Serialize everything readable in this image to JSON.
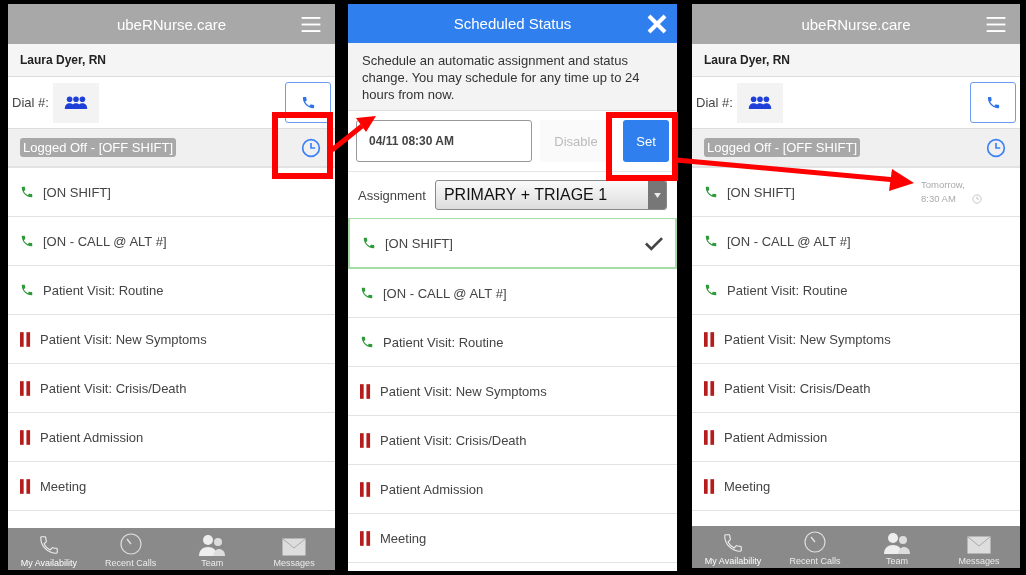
{
  "left_screen": {
    "title": "ubeRNurse.care",
    "user": "Laura Dyer, RN",
    "dial_label": "Dial #:",
    "current_status": "Logged Off - [OFF SHIFT]",
    "statuses": [
      {
        "label": "[ON SHIFT]",
        "kind": "available"
      },
      {
        "label": "[ON - CALL @ ALT #]",
        "kind": "available"
      },
      {
        "label": "Patient Visit: Routine",
        "kind": "available"
      },
      {
        "label": "Patient Visit: New Symptoms",
        "kind": "away"
      },
      {
        "label": "Patient Visit: Crisis/Death",
        "kind": "away"
      },
      {
        "label": "Patient Admission",
        "kind": "away"
      },
      {
        "label": "Meeting",
        "kind": "away"
      }
    ],
    "tabs": [
      {
        "label": "My Availability",
        "kind": "phone",
        "selected": true
      },
      {
        "label": "Recent Calls",
        "kind": "timer",
        "selected": false
      },
      {
        "label": "Team",
        "kind": "people",
        "selected": false
      },
      {
        "label": "Messages",
        "kind": "mail",
        "selected": false
      }
    ]
  },
  "schedule_dialog": {
    "title": "Scheduled Status",
    "description": "Schedule an automatic assignment and status change. You may schedule for any time up to 24 hours from now.",
    "time": "04/11 08:30 AM",
    "disable_button": "Disable",
    "set_button": "Set",
    "assignment_label": "Assignment",
    "assignment": "PRIMARY + TRIAGE 1",
    "statuses": [
      {
        "label": "[ON SHIFT]",
        "kind": "available",
        "selected": true
      },
      {
        "label": "[ON - CALL @ ALT #]",
        "kind": "available",
        "selected": false
      },
      {
        "label": "Patient Visit: Routine",
        "kind": "available",
        "selected": false
      },
      {
        "label": "Patient Visit: New Symptoms",
        "kind": "away",
        "selected": false
      },
      {
        "label": "Patient Visit: Crisis/Death",
        "kind": "away",
        "selected": false
      },
      {
        "label": "Patient Admission",
        "kind": "away",
        "selected": false
      },
      {
        "label": "Meeting",
        "kind": "away",
        "selected": false
      }
    ]
  },
  "right_screen": {
    "title": "ubeRNurse.care",
    "user": "Laura Dyer, RN",
    "dial_label": "Dial #:",
    "current_status": "Logged Off - [OFF SHIFT]",
    "statuses": [
      {
        "label": "[ON SHIFT]",
        "kind": "available",
        "scheduled": "Tomorrow, 8:30 AM"
      },
      {
        "label": "[ON - CALL @ ALT #]",
        "kind": "available"
      },
      {
        "label": "Patient Visit: Routine",
        "kind": "available"
      },
      {
        "label": "Patient Visit: New Symptoms",
        "kind": "away"
      },
      {
        "label": "Patient Visit: Crisis/Death",
        "kind": "away"
      },
      {
        "label": "Patient Admission",
        "kind": "away"
      },
      {
        "label": "Meeting",
        "kind": "away"
      }
    ],
    "tabs": [
      {
        "label": "My Availability",
        "kind": "phone",
        "selected": true
      },
      {
        "label": "Recent Calls",
        "kind": "timer",
        "selected": false
      },
      {
        "label": "Team",
        "kind": "people",
        "selected": false
      },
      {
        "label": "Messages",
        "kind": "mail",
        "selected": false
      }
    ]
  }
}
